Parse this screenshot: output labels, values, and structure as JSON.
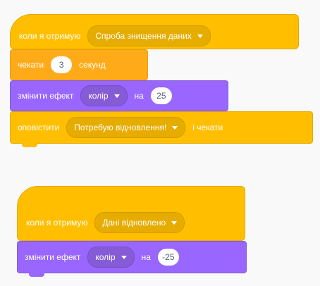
{
  "script1": {
    "hat": {
      "label": "коли я отримую",
      "message": "Спроба знищення даних"
    },
    "wait": {
      "label": "чекати",
      "value": "3",
      "suffix": "секунд"
    },
    "effect": {
      "label": "змінити ефект",
      "effect": "колір",
      "on_label": "на",
      "value": "25"
    },
    "broadcast": {
      "label": "оповістити",
      "message": "Потребую відновлення!",
      "suffix": "і чекати"
    }
  },
  "script2": {
    "hat": {
      "label": "коли я отримую",
      "message": "Дані відновлено"
    },
    "effect": {
      "label": "змінити ефект",
      "effect": "колір",
      "on_label": "на",
      "value": "-25"
    }
  },
  "colors": {
    "events": "#ffbf00",
    "control": "#ffab19",
    "looks": "#9966ff",
    "background": "#f9f9f9"
  }
}
